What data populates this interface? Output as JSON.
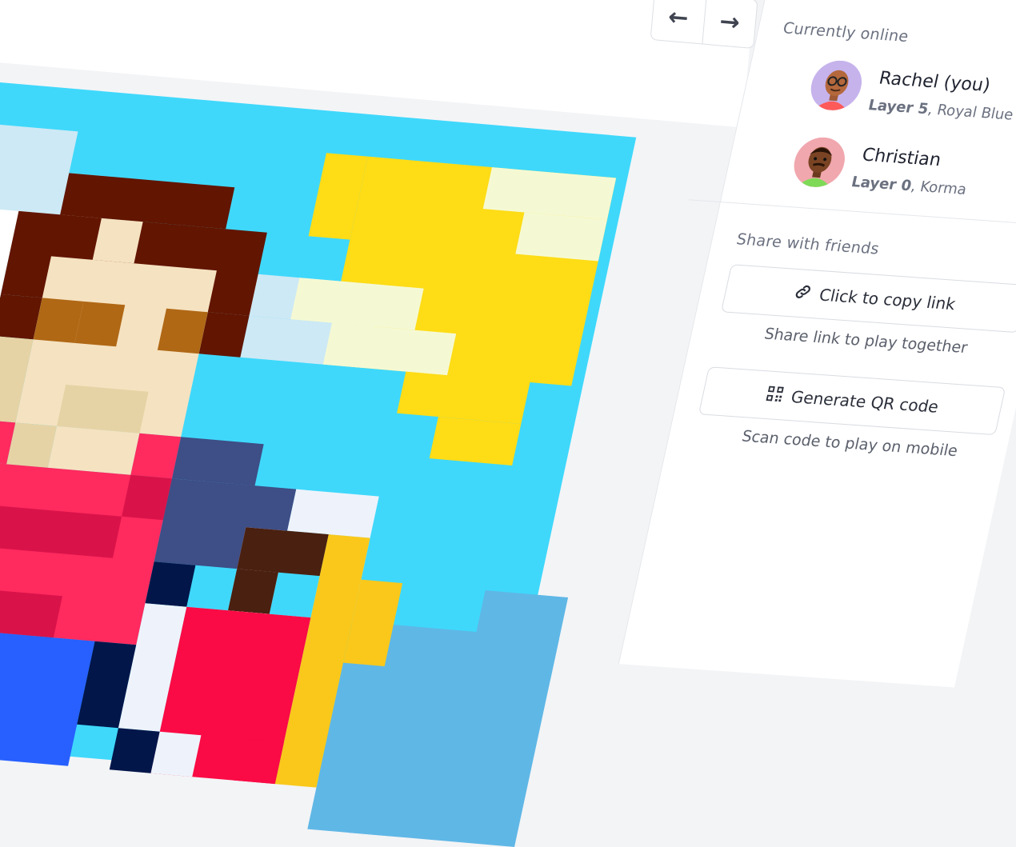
{
  "nav": {
    "back_glyph": "←",
    "forward_glyph": "→"
  },
  "online": {
    "heading": "Currently online",
    "users": [
      {
        "name": "Rachel (you)",
        "layer": "Layer 5",
        "color_name": "Royal Blue",
        "avatar_bg": "#c6b3ec"
      },
      {
        "name": "Christian",
        "layer": "Layer 0",
        "color_name": "Korma",
        "avatar_bg": "#f1a7ae"
      }
    ]
  },
  "share": {
    "heading": "Share with friends",
    "copy_link_label": "Click to copy link",
    "copy_link_caption": "Share link to play together",
    "qr_label": "Generate QR code",
    "qr_caption": "Scan code to play on mobile"
  },
  "canvas_palette": {
    "sky": "#3fd8fb",
    "cloud_light": "#cde9f5",
    "cloud_white": "#ffffff",
    "sun": "#fedc16",
    "sun_light": "#f5f9d3",
    "hair": "#621500",
    "skin": "#f5e2c1",
    "skin_shade": "#e6d3a5",
    "eye": "#b06815",
    "shirt": "#ff2a5e",
    "shirt_shade": "#d9134a",
    "jeans": "#2760ff",
    "navy": "#3e4e86",
    "dark": "#02164a",
    "brown": "#4a2010",
    "yellow": "#f9c81b",
    "red": "#fa0b45",
    "pale": "#eef3fb",
    "ground": "#5fb7e6"
  }
}
